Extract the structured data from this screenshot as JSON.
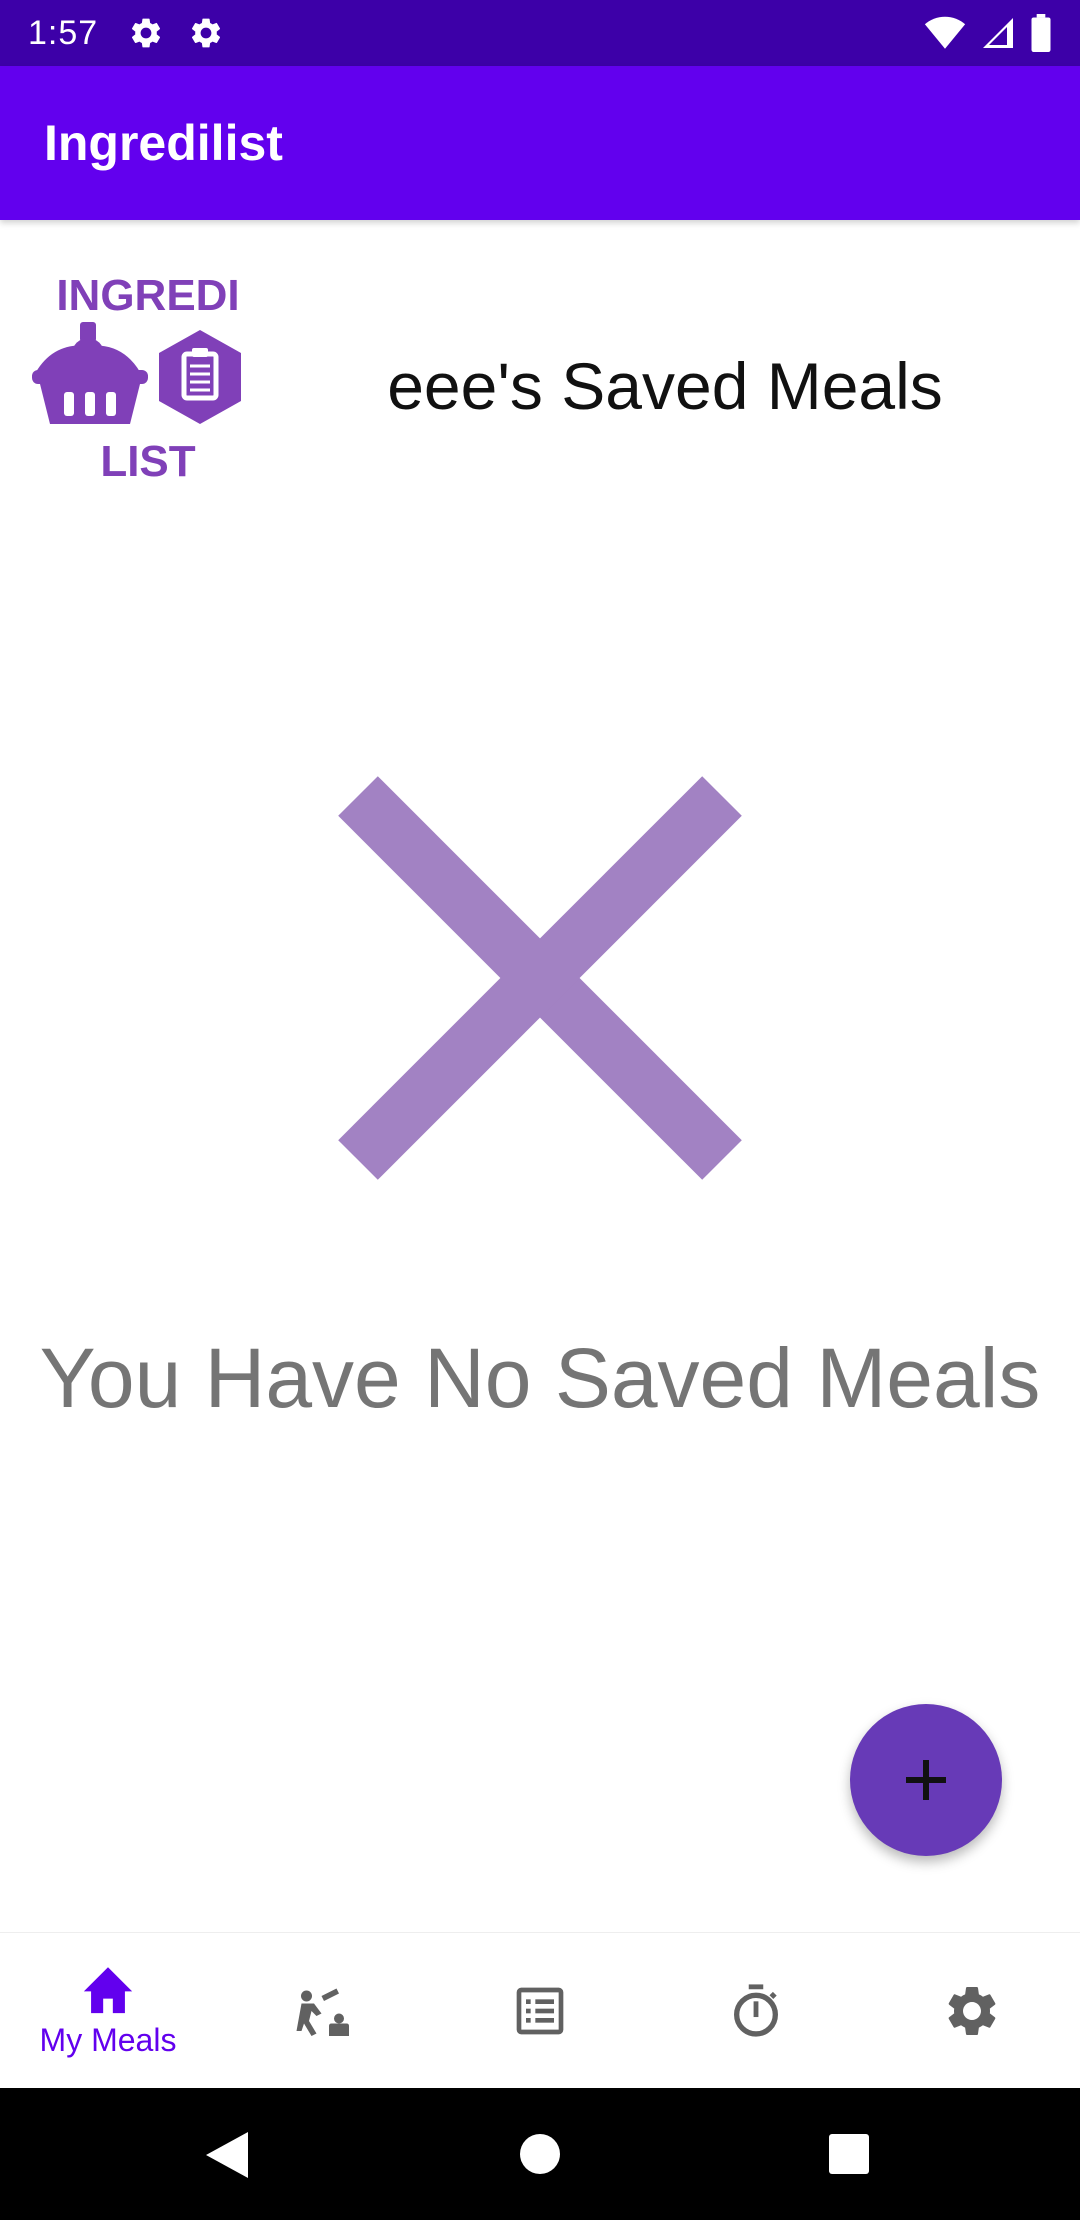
{
  "status_bar": {
    "time": "1:57"
  },
  "app_bar": {
    "title": "Ingredilist"
  },
  "header": {
    "title": "eee's Saved Meals",
    "logo_text_top": "INGREDI",
    "logo_text_bottom": "LIST"
  },
  "empty_state": {
    "message": "You Have No Saved Meals"
  },
  "bottom_nav": {
    "items": [
      {
        "label": "My Meals",
        "icon": "home-icon",
        "active": true
      },
      {
        "label": "",
        "icon": "grocery-icon",
        "active": false
      },
      {
        "label": "",
        "icon": "list-icon",
        "active": false
      },
      {
        "label": "",
        "icon": "timer-icon",
        "active": false
      },
      {
        "label": "",
        "icon": "settings-icon",
        "active": false
      }
    ]
  },
  "colors": {
    "status_bar": "#3d00a8",
    "app_bar": "#6200ee",
    "fab": "#673ab7",
    "accent_purple": "#a282c3",
    "logo_purple": "#8040b8",
    "nav_active": "#6200ee",
    "nav_inactive": "#616161"
  }
}
